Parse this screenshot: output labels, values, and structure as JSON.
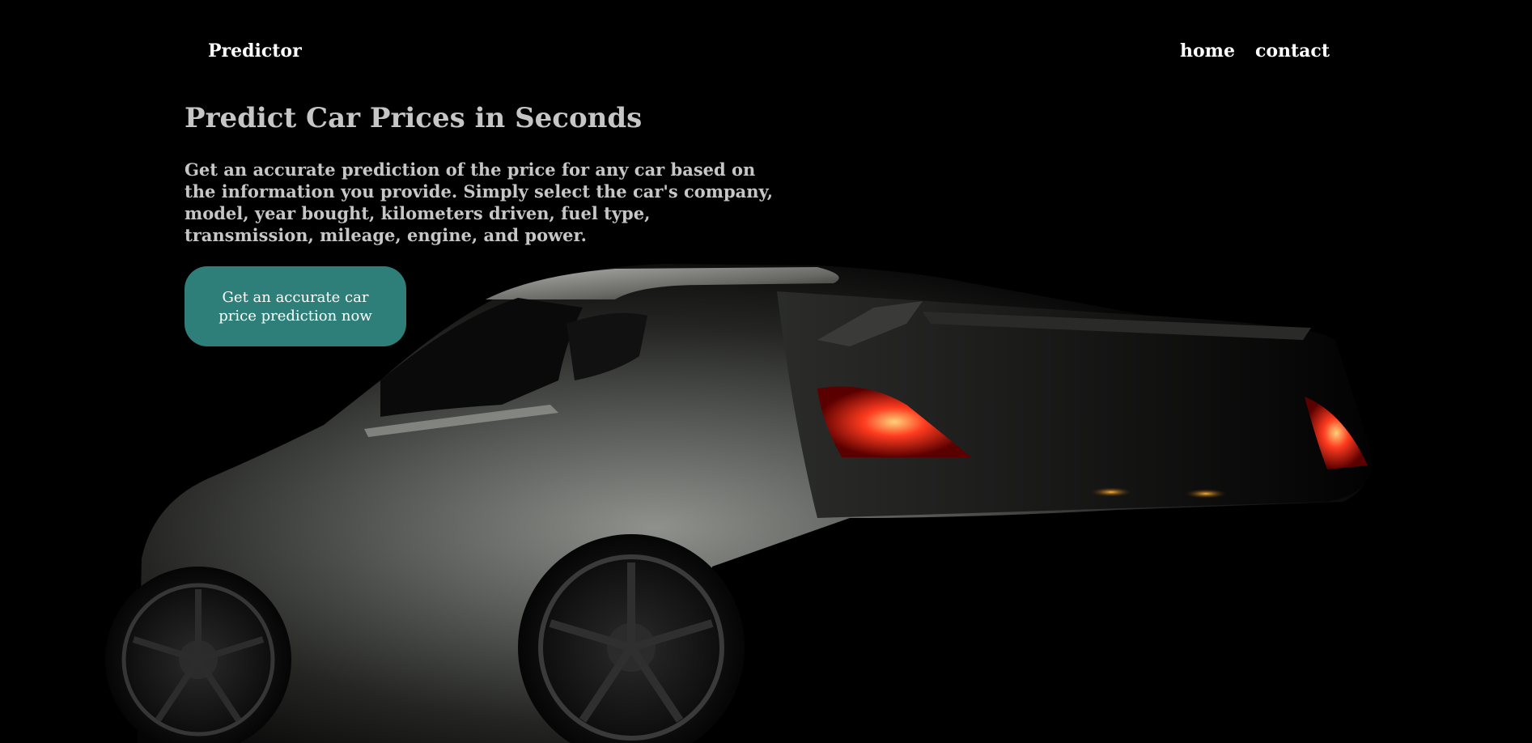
{
  "nav": {
    "brand": "Predictor",
    "links": [
      {
        "label": "home"
      },
      {
        "label": "contact"
      }
    ]
  },
  "hero": {
    "title": "Predict Car Prices in Seconds",
    "description": "Get an accurate prediction of the price for any car based on the information you provide. Simply select the car's company, model, year bought, kilometers driven, fuel type, transmission, mileage, engine, and power.",
    "cta_label": "Get an accurate car price prediction now"
  },
  "colors": {
    "background": "#000000",
    "heading_text": "#c6c6c6",
    "cta_bg": "#2e7f79",
    "taillight": "#ff3b1f"
  },
  "icons": {
    "hero_image": "sports-car-photo"
  }
}
